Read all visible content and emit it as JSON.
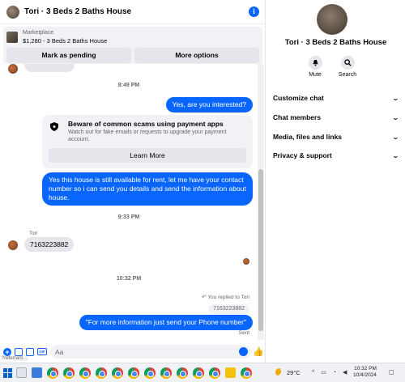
{
  "header": {
    "title": "Tori · 3 Beds 2 Baths House",
    "info_icon": "info-icon"
  },
  "marketplace": {
    "label": "Marketplace",
    "listing": "$1,280 - 3 Beds 2 Baths House",
    "mark_pending": "Mark as pending",
    "more_options": "More options"
  },
  "messages": {
    "time1": "8:49 PM",
    "out1": "Yes, are you interested?",
    "scam": {
      "title": "Beware of common scams using payment apps",
      "desc": "Watch out for fake emails or requests to upgrade your payment account.",
      "button": "Learn More"
    },
    "out2": "Yes this house is still available for rent, let me have your contact number so i can send you details and send the information about house.",
    "time2": "9:33 PM",
    "sender": "Tori",
    "in1": "7163223882",
    "time3": "10:32 PM",
    "replied": "You replied to Tori",
    "quote": "7163223882",
    "out3": "\"For more information just send your Phone number\"",
    "sent": "Sent"
  },
  "composer": {
    "placeholder": "Aa",
    "referral": "?referralS..."
  },
  "sidebar": {
    "name": "Tori · 3 Beds 2 Baths House",
    "mute": "Mute",
    "search": "Search",
    "sections": [
      "Customize chat",
      "Chat members",
      "Media, files and links",
      "Privacy & support"
    ]
  },
  "taskbar": {
    "temperature": "29°C",
    "time": "10:32 PM",
    "date": "10/4/2024"
  },
  "colors": {
    "accent": "#0866ff",
    "bubble_in": "#e4e6eb",
    "surface": "#f0f2f5"
  }
}
